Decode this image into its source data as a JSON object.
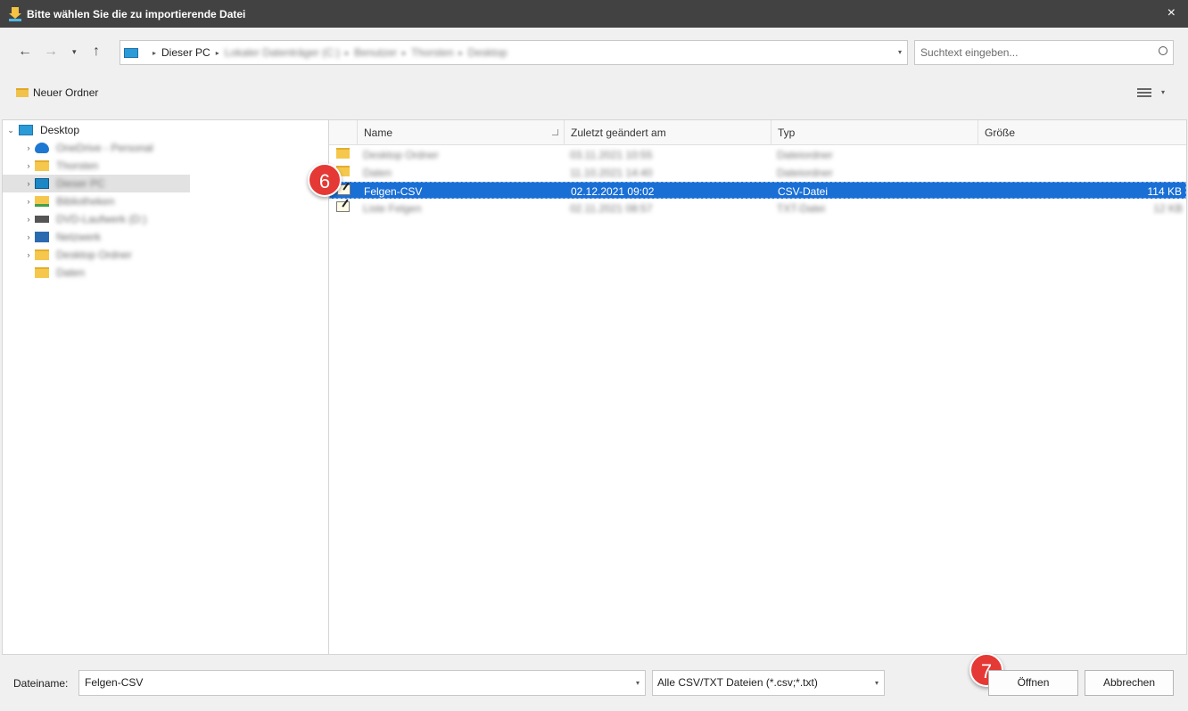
{
  "window": {
    "title": "Bitte wählen Sie die zu importierende Datei",
    "close_glyph": "×"
  },
  "nav": {
    "back_glyph": "←",
    "forward_glyph": "→",
    "recent_glyph": "▾",
    "up_glyph": "↑"
  },
  "address": {
    "crumbs": [
      "Dieser PC",
      "Lokaler Datenträger (C:)",
      "Benutzer",
      "Thorsten",
      "Desktop"
    ],
    "separator": "▸",
    "dropdown_glyph": "▾"
  },
  "search": {
    "placeholder": "Suchtext eingeben..."
  },
  "toolbar": {
    "new_folder_label": "Neuer Ordner",
    "view_dropdown_glyph": "▾"
  },
  "tree": {
    "items": [
      {
        "label": "Desktop",
        "icon": "desktop-icon",
        "chevron": "⌄"
      },
      {
        "label": "OneDrive - Personal",
        "icon": "cloud-icon",
        "chevron": "›"
      },
      {
        "label": "Thorsten",
        "icon": "folder-icon",
        "chevron": "›"
      },
      {
        "label": "Dieser PC",
        "icon": "monitor-icon",
        "chevron": "›"
      },
      {
        "label": "Bibliotheken",
        "icon": "library-icon",
        "chevron": "›"
      },
      {
        "label": "DVD-Laufwerk (D:)",
        "icon": "drive-icon",
        "chevron": "›"
      },
      {
        "label": "Netzwerk",
        "icon": "network-icon",
        "chevron": "›"
      },
      {
        "label": "Desktop Ordner",
        "icon": "folder-icon",
        "chevron": "›"
      },
      {
        "label": "Daten",
        "icon": "folder-icon",
        "chevron": ""
      }
    ]
  },
  "columns": {
    "name": "Name",
    "modified": "Zuletzt geändert am",
    "type": "Typ",
    "size": "Größe"
  },
  "files": [
    {
      "name": "Desktop Ordner",
      "modified": "03.11.2021 10:55",
      "type": "Dateiordner",
      "size": "",
      "icon": "folder-icon"
    },
    {
      "name": "Daten",
      "modified": "11.10.2021 14:40",
      "type": "Dateiordner",
      "size": "",
      "icon": "folder-icon"
    },
    {
      "name": "Felgen-CSV",
      "modified": "02.12.2021 09:02",
      "type": "CSV-Datei",
      "size": "114 KB",
      "icon": "csv-file-icon"
    },
    {
      "name": "Liste Felgen",
      "modified": "02.11.2021 08:57",
      "type": "TXT-Datei",
      "size": "12 KB",
      "icon": "csv-file-icon"
    }
  ],
  "badges": {
    "step_select": "6",
    "step_open": "7"
  },
  "footer": {
    "filename_label": "Dateiname:",
    "filename_value": "Felgen-CSV",
    "filter_value": "Alle CSV/TXT Dateien (*.csv;*.txt)",
    "dropdown_glyph": "▾",
    "open_label": "Öffnen",
    "cancel_label": "Abbrechen"
  }
}
